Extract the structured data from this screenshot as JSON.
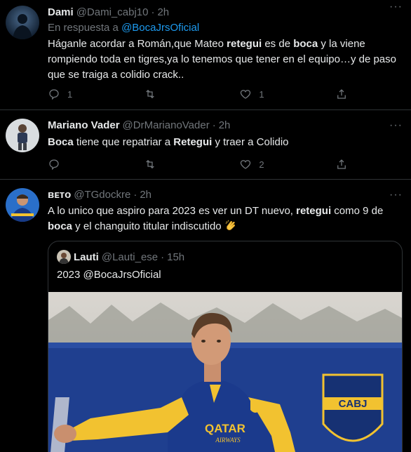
{
  "tweets": [
    {
      "name": "Dami",
      "handle": "@Dami_cabj10",
      "sep": "·",
      "time": "2h",
      "more": "···",
      "reply_prefix": "En respuesta a ",
      "reply_link": "@BocaJrsOficial",
      "text_parts": [
        "Háganle acordar a Román,que Mateo ",
        "retegui",
        " es de ",
        "boca",
        " y la viene rompiendo toda en tigres,ya lo tenemos que tener en el equipo…y de paso que se traiga a colidio crack.."
      ],
      "reply_count": "1",
      "retweet_count": "",
      "like_count": "1"
    },
    {
      "name": "Mariano Vader",
      "handle": "@DrMarianoVader",
      "sep": "·",
      "time": "2h",
      "more": "···",
      "text_parts": [
        "Boca",
        " tiene que repatriar a ",
        "Retegui",
        " y traer a Colidio"
      ],
      "reply_count": "",
      "retweet_count": "",
      "like_count": "2"
    },
    {
      "name": "ʙᴇᴛᴏ",
      "handle": "@TGdockre",
      "sep": "·",
      "time": "2h",
      "more": "···",
      "text_parts": [
        "A lo unico que aspiro para 2023 es ver un DT nuevo, ",
        "retegui",
        " como 9 de ",
        "boca",
        " y el changuito titular indiscutido "
      ],
      "emoji": "clapping-hands-emoji"
    }
  ],
  "quote": {
    "name": "Lauti",
    "handle": "@Lauti_ese",
    "sep": "·",
    "time": "15h",
    "text": "2023 @BocaJrsOficial",
    "shirt_sponsor": "QATAR",
    "shirt_sub": "AIRWAYS",
    "crest_text": "CABJ"
  },
  "colors": {
    "background": "#000000",
    "text": "#e7e9ea",
    "muted": "#71767b",
    "link": "#1d9bf0",
    "divider": "#2f3336",
    "boca_blue": "#1b3a8c",
    "boca_yellow": "#f2c230"
  }
}
